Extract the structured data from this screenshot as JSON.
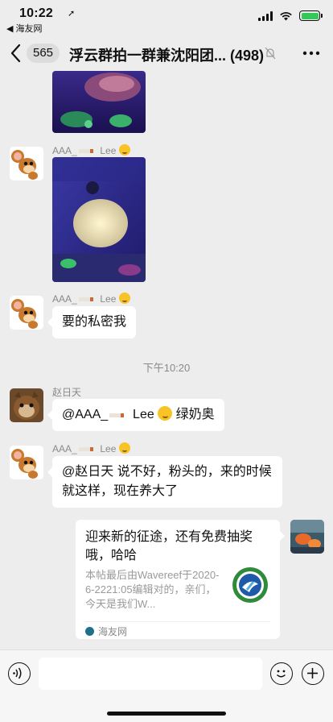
{
  "status_bar": {
    "time": "10:22",
    "back_app": "◀ 海友网"
  },
  "nav": {
    "unread_count": "565",
    "title": "浮云群拍一群兼沈阳团...",
    "member_count": "(498)"
  },
  "messages": [
    {
      "type": "image",
      "sender": "",
      "description": "coral-photo-top"
    },
    {
      "type": "image",
      "sender_name": "AAA_",
      "sender_suffix": "Lee",
      "description": "anemone-photo"
    },
    {
      "type": "text",
      "sender_name": "AAA_",
      "sender_suffix": "Lee",
      "text": "要的私密我"
    },
    {
      "type": "time",
      "text": "下午10:20"
    },
    {
      "type": "text",
      "sender_name": "赵日天",
      "text_prefix": "@AAA_",
      "text_mid": "Lee",
      "text_suffix": "绿奶奥"
    },
    {
      "type": "text",
      "sender_name": "AAA_",
      "sender_suffix": "Lee",
      "text": "@赵日天 说不好，粉头的，来的时候就这样，现在养大了"
    },
    {
      "type": "link",
      "title": "迎来新的征途，还有免费抽奖哦，哈哈",
      "description": "本帖最后由Wavereef于2020-6-2221:05编辑对的，亲们，今天是我们W...",
      "source": "海友网"
    }
  ],
  "input": {
    "placeholder": ""
  },
  "colors": {
    "background": "#ededed",
    "bubble": "#ffffff",
    "battery": "#34c759"
  }
}
